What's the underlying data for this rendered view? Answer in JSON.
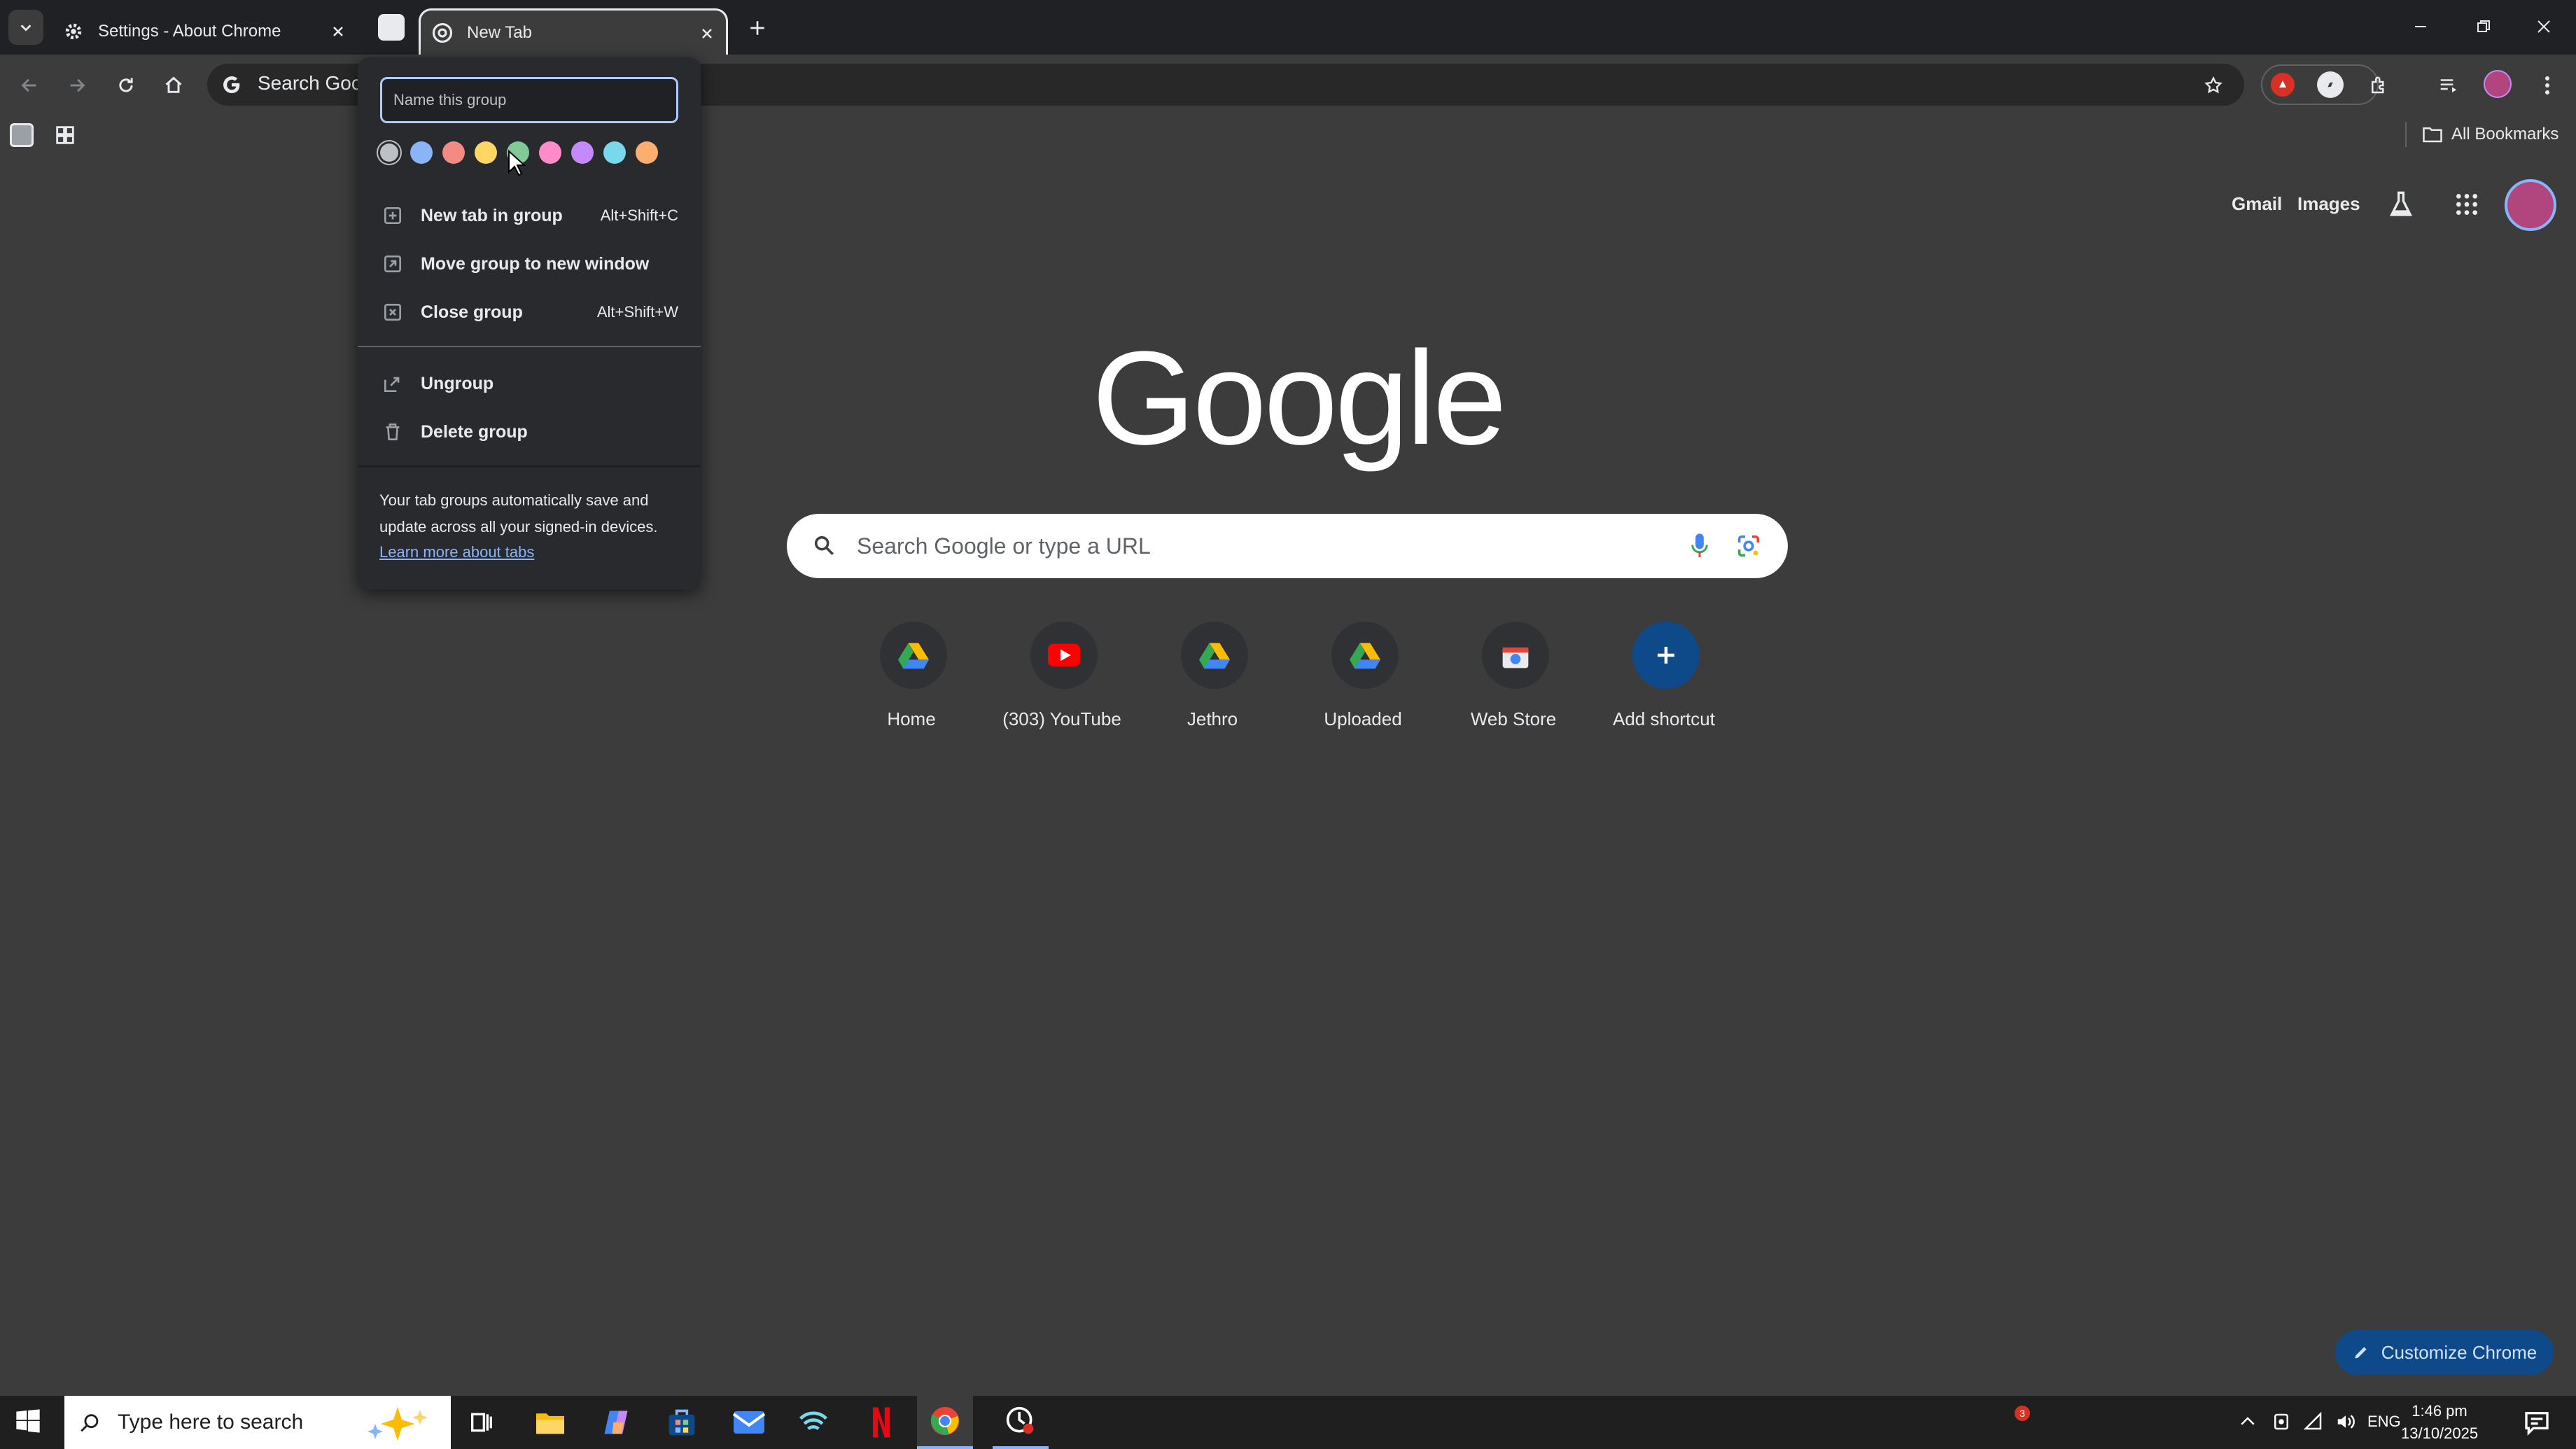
{
  "tabs": {
    "settings_title": "Settings - About Chrome",
    "newtab_title": "New Tab"
  },
  "omnibox": {
    "text": "Search Google or type a URL"
  },
  "bookmarks": {
    "all_bookmarks": "All Bookmarks"
  },
  "tab_group_menu": {
    "name_placeholder": "Name this group",
    "colors": [
      "#bdc1c6",
      "#8ab4f8",
      "#f28b82",
      "#fdd663",
      "#81c995",
      "#ff8bcb",
      "#c58af9",
      "#78d9ec",
      "#fcad70"
    ],
    "items": [
      {
        "label": "New tab in group",
        "shortcut": "Alt+Shift+C"
      },
      {
        "label": "Move group to new window",
        "shortcut": ""
      },
      {
        "label": "Close group",
        "shortcut": "Alt+Shift+W"
      },
      {
        "label": "Ungroup",
        "shortcut": ""
      },
      {
        "label": "Delete group",
        "shortcut": ""
      }
    ],
    "note": "Your tab groups automatically save and update across all your signed-in devices.",
    "link": "Learn more about tabs"
  },
  "ntp": {
    "logo": "Google",
    "search_placeholder": "Search Google or type a URL",
    "gmail": "Gmail",
    "images": "Images",
    "shortcuts": [
      {
        "label": "Home",
        "icon": "google-drive-icon"
      },
      {
        "label": "(303) YouTube",
        "icon": "youtube-icon"
      },
      {
        "label": "Jethro",
        "icon": "google-drive-icon"
      },
      {
        "label": "Uploaded",
        "icon": "google-drive-icon"
      },
      {
        "label": "Web Store",
        "icon": "web-store-icon"
      },
      {
        "label": "Add shortcut",
        "icon": "plus-icon"
      }
    ],
    "customize": "Customize Chrome"
  },
  "taskbar": {
    "search_placeholder": "Type here to search",
    "language": "ENG",
    "time": "1:46 pm",
    "date": "13/10/2025",
    "notification_count": "3"
  },
  "colors": {
    "background": "#3c3c3c",
    "accent": "#8ab4f8"
  }
}
